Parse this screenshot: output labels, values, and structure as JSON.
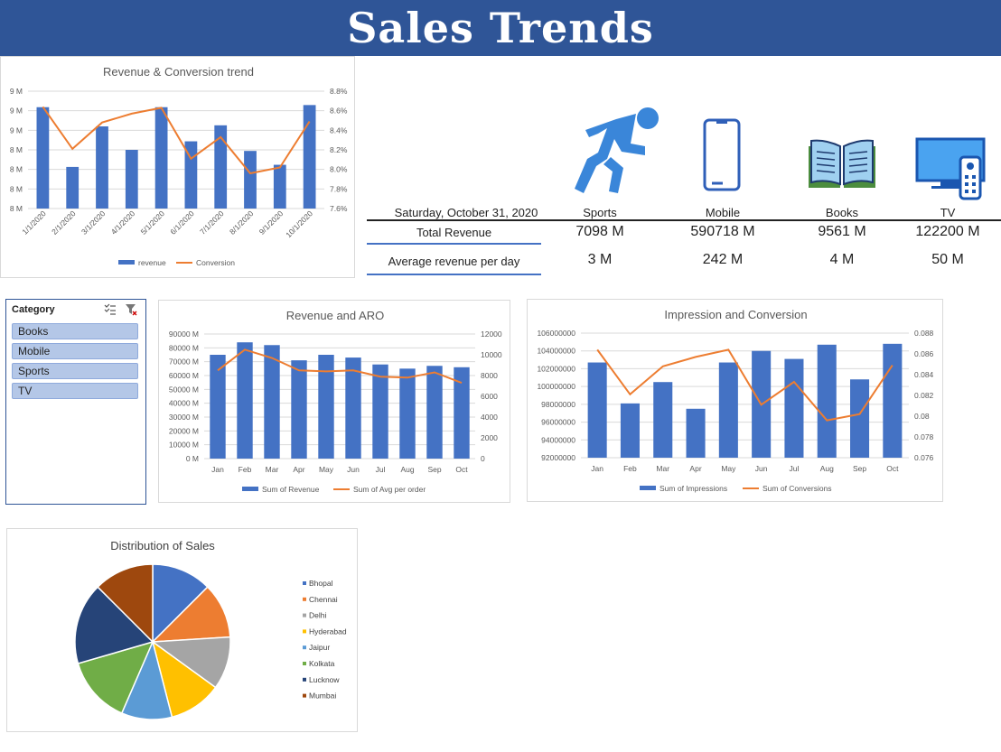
{
  "header": {
    "title": "Sales Trends"
  },
  "kpi": {
    "date": "Saturday, October 31, 2020",
    "columns": [
      "Sports",
      "Mobile",
      "Books",
      "TV"
    ],
    "rows": [
      {
        "label": "Total Revenue",
        "values": [
          "7098 M",
          "590718 M",
          "9561 M",
          "122200 M"
        ]
      },
      {
        "label": "Average revenue per day",
        "values": [
          "3 M",
          "242 M",
          "4 M",
          "50 M"
        ]
      }
    ],
    "icons": [
      "running-person-icon",
      "smartphone-icon",
      "open-book-icon",
      "tv-remote-icon"
    ]
  },
  "slicer": {
    "title": "Category",
    "items": [
      "Books",
      "Mobile",
      "Sports",
      "TV"
    ]
  },
  "colors": {
    "bar": "#4472c4",
    "line": "#ed7d31",
    "banner": "#2f5597"
  },
  "chart_data": [
    {
      "id": "revenue-conversion",
      "type": "bar+line",
      "title": "Revenue & Conversion trend",
      "categories": [
        "1/1/2020",
        "2/1/2020",
        "3/1/2020",
        "4/1/2020",
        "5/1/2020",
        "6/1/2020",
        "7/1/2020",
        "8/1/2020",
        "9/1/2020",
        "10/1/2020"
      ],
      "y_ticks": [
        "8 M",
        "8 M",
        "8 M",
        "8 M",
        "9 M",
        "9 M",
        "9 M"
      ],
      "y2_ticks": [
        "7.6%",
        "7.8%",
        "8.0%",
        "8.2%",
        "8.4%",
        "8.6%",
        "8.8%"
      ],
      "series": [
        {
          "name": "revenue",
          "values": [
            8.75,
            8.19,
            8.57,
            8.35,
            8.75,
            8.43,
            8.58,
            8.34,
            8.21,
            8.77
          ]
        },
        {
          "name": "Conversion",
          "values": [
            8.64,
            8.21,
            8.48,
            8.57,
            8.63,
            8.11,
            8.33,
            7.96,
            8.02,
            8.49
          ]
        }
      ],
      "ylim": [
        7.8,
        8.9
      ],
      "y2lim": [
        7.6,
        8.8
      ],
      "legend": "bottom"
    },
    {
      "id": "revenue-aro",
      "type": "bar+line",
      "title": "Revenue and ARO",
      "categories": [
        "Jan",
        "Feb",
        "Mar",
        "Apr",
        "May",
        "Jun",
        "Jul",
        "Aug",
        "Sep",
        "Oct"
      ],
      "y_ticks": [
        "0 M",
        "10000 M",
        "20000 M",
        "30000 M",
        "40000 M",
        "50000 M",
        "60000 M",
        "70000 M",
        "80000 M",
        "90000 M"
      ],
      "y2_ticks": [
        "0",
        "2000",
        "4000",
        "6000",
        "8000",
        "10000",
        "12000"
      ],
      "series": [
        {
          "name": "Sum of Revenue",
          "values": [
            75000,
            84000,
            82000,
            71000,
            75000,
            73000,
            68000,
            65000,
            67000,
            66000
          ]
        },
        {
          "name": "Sum of Avg per order",
          "values": [
            8500,
            10500,
            9700,
            8500,
            8400,
            8500,
            7900,
            7800,
            8300,
            7300
          ]
        }
      ],
      "ylim": [
        0,
        90000
      ],
      "y2lim": [
        0,
        12000
      ],
      "legend": "bottom"
    },
    {
      "id": "impression-conversion",
      "type": "bar+line",
      "title": "Impression and Conversion",
      "categories": [
        "Jan",
        "Feb",
        "Mar",
        "Apr",
        "May",
        "Jun",
        "Jul",
        "Aug",
        "Sep",
        "Oct"
      ],
      "y_ticks": [
        "92000000",
        "94000000",
        "96000000",
        "98000000",
        "100000000",
        "102000000",
        "104000000",
        "106000000"
      ],
      "y2_ticks": [
        "0.076",
        "0.078",
        "0.08",
        "0.082",
        "0.084",
        "0.086",
        "0.088"
      ],
      "series": [
        {
          "name": "Sum of Impressions",
          "values": [
            102700000,
            98100000,
            100500000,
            97500000,
            102700000,
            104000000,
            103100000,
            104700000,
            100800000,
            104800000
          ]
        },
        {
          "name": "Sum of Conversions",
          "values": [
            0.0864,
            0.0821,
            0.0848,
            0.0857,
            0.0864,
            0.0811,
            0.0833,
            0.0796,
            0.0802,
            0.0849
          ]
        }
      ],
      "ylim": [
        92000000,
        106000000
      ],
      "y2lim": [
        0.076,
        0.088
      ],
      "legend": "bottom"
    },
    {
      "id": "distribution-of-sales",
      "type": "pie",
      "title": "Distribution of Sales",
      "categories": [
        "Bhopal",
        "Chennai",
        "Delhi",
        "Hyderabad",
        "Jaipur",
        "Kolkata",
        "Lucknow",
        "Mumbai"
      ],
      "values": [
        12.5,
        11.5,
        11,
        11,
        10.5,
        14,
        17,
        12.5
      ],
      "colors": [
        "#4472c4",
        "#ed7d31",
        "#a5a5a5",
        "#ffc000",
        "#5b9bd5",
        "#70ad47",
        "#264478",
        "#9e480e"
      ],
      "legend": "right"
    }
  ]
}
